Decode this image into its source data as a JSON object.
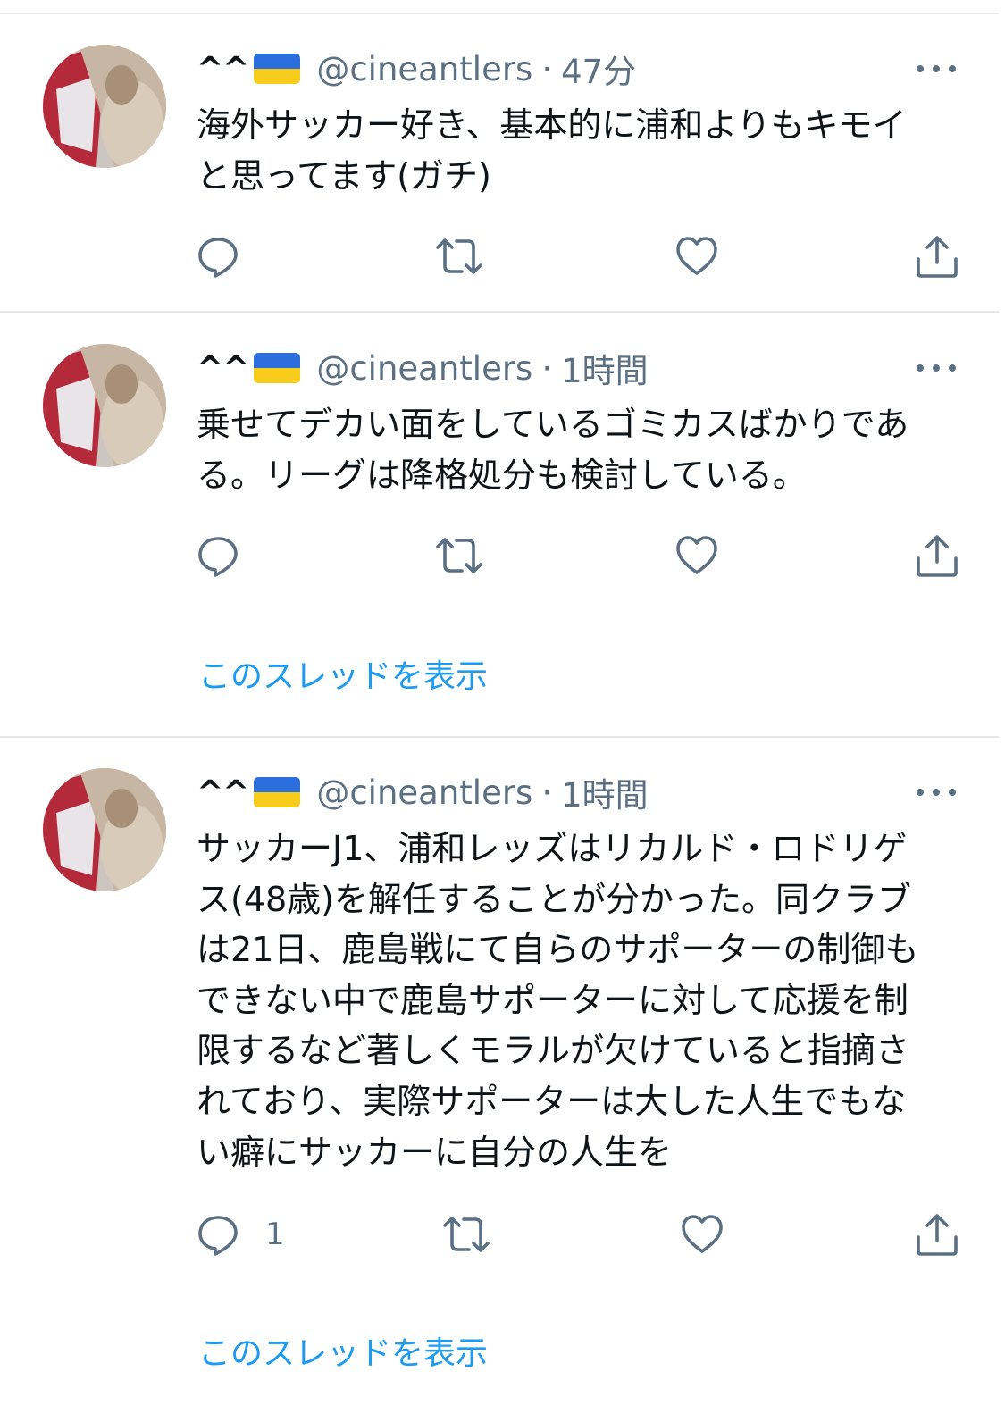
{
  "tweets": [
    {
      "display_name": "^^",
      "flag": "ukraine-flag",
      "handle": "@cineantlers",
      "separator": "·",
      "time": "47分",
      "text": "海外サッカー好き、基本的に浦和よりもキモイ\nと思ってます(ガチ)",
      "reply_count": ""
    },
    {
      "display_name": "^^",
      "flag": "ukraine-flag",
      "handle": "@cineantlers",
      "separator": "·",
      "time": "1時間",
      "text": "乗せてデカい面をしているゴミカスばかりであ\nる。リーグは降格処分も検討している。",
      "reply_count": "",
      "thread_link": "このスレッドを表示"
    },
    {
      "display_name": "^^",
      "flag": "ukraine-flag",
      "handle": "@cineantlers",
      "separator": "·",
      "time": "1時間",
      "text": "サッカーJ1、浦和レッズはリカルド・ロドリゲ\nス(48歳)を解任することが分かった。同クラブ\nは21日、鹿島戦にて自らのサポーターの制御も\nできない中で鹿島サポーターに対して応援を制\n限するなど著しくモラルが欠けていると指摘さ\nれており、実際サポーターは大した人生でもな\nい癖にサッカーに自分の人生を",
      "reply_count": "1",
      "thread_link": "このスレッドを表示"
    }
  ],
  "colors": {
    "text": "#0f1419",
    "secondary": "#5b7083",
    "link": "#1d9bf0",
    "divider": "#e6e9ec",
    "flag_blue": "#2b6fde",
    "flag_yellow": "#f8cc1b"
  },
  "icons": [
    "reply-icon",
    "retweet-icon",
    "like-icon",
    "share-icon",
    "more-icon"
  ]
}
